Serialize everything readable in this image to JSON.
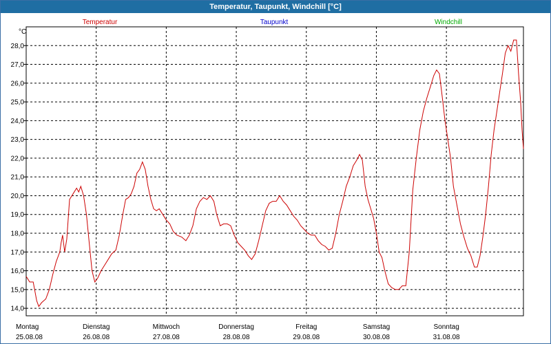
{
  "window": {
    "title": "Temperatur, Taupunkt, Windchill [°C]"
  },
  "chart_data": {
    "type": "line",
    "title": "Temperatur, Taupunkt, Windchill [°C]",
    "ylabel": "°C",
    "ylim": [
      13.6,
      29.0
    ],
    "yticks": [
      14.0,
      15.0,
      16.0,
      17.0,
      18.0,
      19.0,
      20.0,
      21.0,
      22.0,
      23.0,
      24.0,
      25.0,
      26.0,
      27.0,
      28.0
    ],
    "ytick_labels": [
      "14,0",
      "15,0",
      "16,0",
      "17,0",
      "18,0",
      "19,0",
      "20,0",
      "21,0",
      "22,0",
      "23,0",
      "24,0",
      "25,0",
      "26,0",
      "27,0",
      "28,0"
    ],
    "xlim": [
      0,
      7.1
    ],
    "grid": true,
    "legend_position": "top",
    "x_ticks": [
      {
        "x": 0,
        "day": "Montag",
        "date": "25.08.08"
      },
      {
        "x": 1,
        "day": "Dienstag",
        "date": "26.08.08"
      },
      {
        "x": 2,
        "day": "Mittwoch",
        "date": "27.08.08"
      },
      {
        "x": 3,
        "day": "Donnerstag",
        "date": "28.08.08"
      },
      {
        "x": 4,
        "day": "Freitag",
        "date": "29.08.08"
      },
      {
        "x": 5,
        "day": "Samstag",
        "date": "30.08.08"
      },
      {
        "x": 6,
        "day": "Sonntag",
        "date": "31.08.08"
      }
    ],
    "series": [
      {
        "name": "Temperatur",
        "color": "#cc0000",
        "points": [
          [
            0.0,
            15.7
          ],
          [
            0.05,
            15.4
          ],
          [
            0.1,
            15.4
          ],
          [
            0.15,
            14.4
          ],
          [
            0.18,
            14.1
          ],
          [
            0.22,
            14.3
          ],
          [
            0.28,
            14.5
          ],
          [
            0.33,
            15.0
          ],
          [
            0.38,
            15.8
          ],
          [
            0.43,
            16.5
          ],
          [
            0.48,
            17.0
          ],
          [
            0.5,
            17.5
          ],
          [
            0.52,
            17.9
          ],
          [
            0.55,
            17.0
          ],
          [
            0.58,
            17.7
          ],
          [
            0.62,
            19.8
          ],
          [
            0.67,
            20.1
          ],
          [
            0.72,
            20.4
          ],
          [
            0.75,
            20.2
          ],
          [
            0.78,
            20.5
          ],
          [
            0.82,
            20.0
          ],
          [
            0.86,
            19.0
          ],
          [
            0.9,
            17.5
          ],
          [
            0.94,
            16.0
          ],
          [
            0.98,
            15.4
          ],
          [
            1.02,
            15.6
          ],
          [
            1.07,
            16.0
          ],
          [
            1.12,
            16.3
          ],
          [
            1.17,
            16.6
          ],
          [
            1.22,
            16.9
          ],
          [
            1.28,
            17.1
          ],
          [
            1.33,
            17.9
          ],
          [
            1.38,
            19.0
          ],
          [
            1.42,
            19.8
          ],
          [
            1.46,
            19.9
          ],
          [
            1.5,
            20.1
          ],
          [
            1.54,
            20.5
          ],
          [
            1.58,
            21.2
          ],
          [
            1.62,
            21.4
          ],
          [
            1.66,
            21.8
          ],
          [
            1.7,
            21.4
          ],
          [
            1.74,
            20.5
          ],
          [
            1.78,
            19.8
          ],
          [
            1.82,
            19.3
          ],
          [
            1.86,
            19.2
          ],
          [
            1.9,
            19.3
          ],
          [
            1.95,
            19.0
          ],
          [
            2.0,
            18.7
          ],
          [
            2.05,
            18.5
          ],
          [
            2.1,
            18.1
          ],
          [
            2.15,
            17.9
          ],
          [
            2.22,
            17.8
          ],
          [
            2.28,
            17.6
          ],
          [
            2.33,
            17.9
          ],
          [
            2.38,
            18.4
          ],
          [
            2.43,
            19.3
          ],
          [
            2.48,
            19.7
          ],
          [
            2.53,
            19.9
          ],
          [
            2.58,
            19.8
          ],
          [
            2.63,
            20.0
          ],
          [
            2.68,
            19.7
          ],
          [
            2.72,
            19.0
          ],
          [
            2.77,
            18.4
          ],
          [
            2.82,
            18.5
          ],
          [
            2.87,
            18.5
          ],
          [
            2.92,
            18.4
          ],
          [
            2.97,
            17.9
          ],
          [
            3.02,
            17.5
          ],
          [
            3.07,
            17.3
          ],
          [
            3.12,
            17.1
          ],
          [
            3.17,
            16.8
          ],
          [
            3.22,
            16.6
          ],
          [
            3.27,
            16.9
          ],
          [
            3.32,
            17.6
          ],
          [
            3.37,
            18.4
          ],
          [
            3.42,
            19.2
          ],
          [
            3.47,
            19.6
          ],
          [
            3.52,
            19.7
          ],
          [
            3.57,
            19.7
          ],
          [
            3.62,
            20.0
          ],
          [
            3.67,
            19.7
          ],
          [
            3.72,
            19.5
          ],
          [
            3.77,
            19.2
          ],
          [
            3.82,
            18.9
          ],
          [
            3.87,
            18.7
          ],
          [
            3.92,
            18.4
          ],
          [
            3.97,
            18.2
          ],
          [
            4.02,
            18.0
          ],
          [
            4.07,
            17.9
          ],
          [
            4.12,
            17.9
          ],
          [
            4.17,
            17.6
          ],
          [
            4.22,
            17.4
          ],
          [
            4.27,
            17.3
          ],
          [
            4.32,
            17.1
          ],
          [
            4.37,
            17.2
          ],
          [
            4.42,
            18.0
          ],
          [
            4.47,
            19.0
          ],
          [
            4.52,
            19.7
          ],
          [
            4.57,
            20.5
          ],
          [
            4.62,
            21.0
          ],
          [
            4.67,
            21.6
          ],
          [
            4.72,
            21.9
          ],
          [
            4.76,
            22.2
          ],
          [
            4.8,
            21.9
          ],
          [
            4.84,
            20.5
          ],
          [
            4.88,
            19.8
          ],
          [
            4.92,
            19.3
          ],
          [
            4.96,
            18.8
          ],
          [
            5.0,
            18.0
          ],
          [
            5.04,
            17.0
          ],
          [
            5.08,
            16.7
          ],
          [
            5.12,
            16.0
          ],
          [
            5.17,
            15.3
          ],
          [
            5.22,
            15.1
          ],
          [
            5.27,
            15.0
          ],
          [
            5.32,
            15.0
          ],
          [
            5.37,
            15.2
          ],
          [
            5.42,
            15.2
          ],
          [
            5.47,
            17.0
          ],
          [
            5.52,
            20.3
          ],
          [
            5.57,
            22.0
          ],
          [
            5.62,
            23.5
          ],
          [
            5.67,
            24.5
          ],
          [
            5.72,
            25.2
          ],
          [
            5.77,
            25.8
          ],
          [
            5.82,
            26.4
          ],
          [
            5.86,
            26.7
          ],
          [
            5.9,
            26.5
          ],
          [
            5.94,
            25.3
          ],
          [
            5.98,
            24.0
          ],
          [
            6.02,
            23.0
          ],
          [
            6.06,
            22.0
          ],
          [
            6.1,
            20.5
          ],
          [
            6.15,
            19.5
          ],
          [
            6.2,
            18.5
          ],
          [
            6.25,
            17.8
          ],
          [
            6.3,
            17.2
          ],
          [
            6.35,
            16.8
          ],
          [
            6.4,
            16.2
          ],
          [
            6.44,
            16.2
          ],
          [
            6.48,
            16.8
          ],
          [
            6.52,
            17.8
          ],
          [
            6.56,
            19.0
          ],
          [
            6.6,
            20.5
          ],
          [
            6.64,
            22.2
          ],
          [
            6.68,
            23.5
          ],
          [
            6.72,
            24.5
          ],
          [
            6.76,
            25.5
          ],
          [
            6.8,
            26.5
          ],
          [
            6.84,
            27.6
          ],
          [
            6.88,
            28.0
          ],
          [
            6.92,
            27.7
          ],
          [
            6.96,
            28.3
          ],
          [
            7.0,
            28.3
          ],
          [
            7.03,
            26.5
          ],
          [
            7.06,
            25.0
          ],
          [
            7.08,
            23.5
          ],
          [
            7.1,
            22.5
          ]
        ]
      },
      {
        "name": "Taupunkt",
        "color": "#0000cc",
        "points": []
      },
      {
        "name": "Windchill",
        "color": "#00aa00",
        "points": []
      }
    ]
  }
}
